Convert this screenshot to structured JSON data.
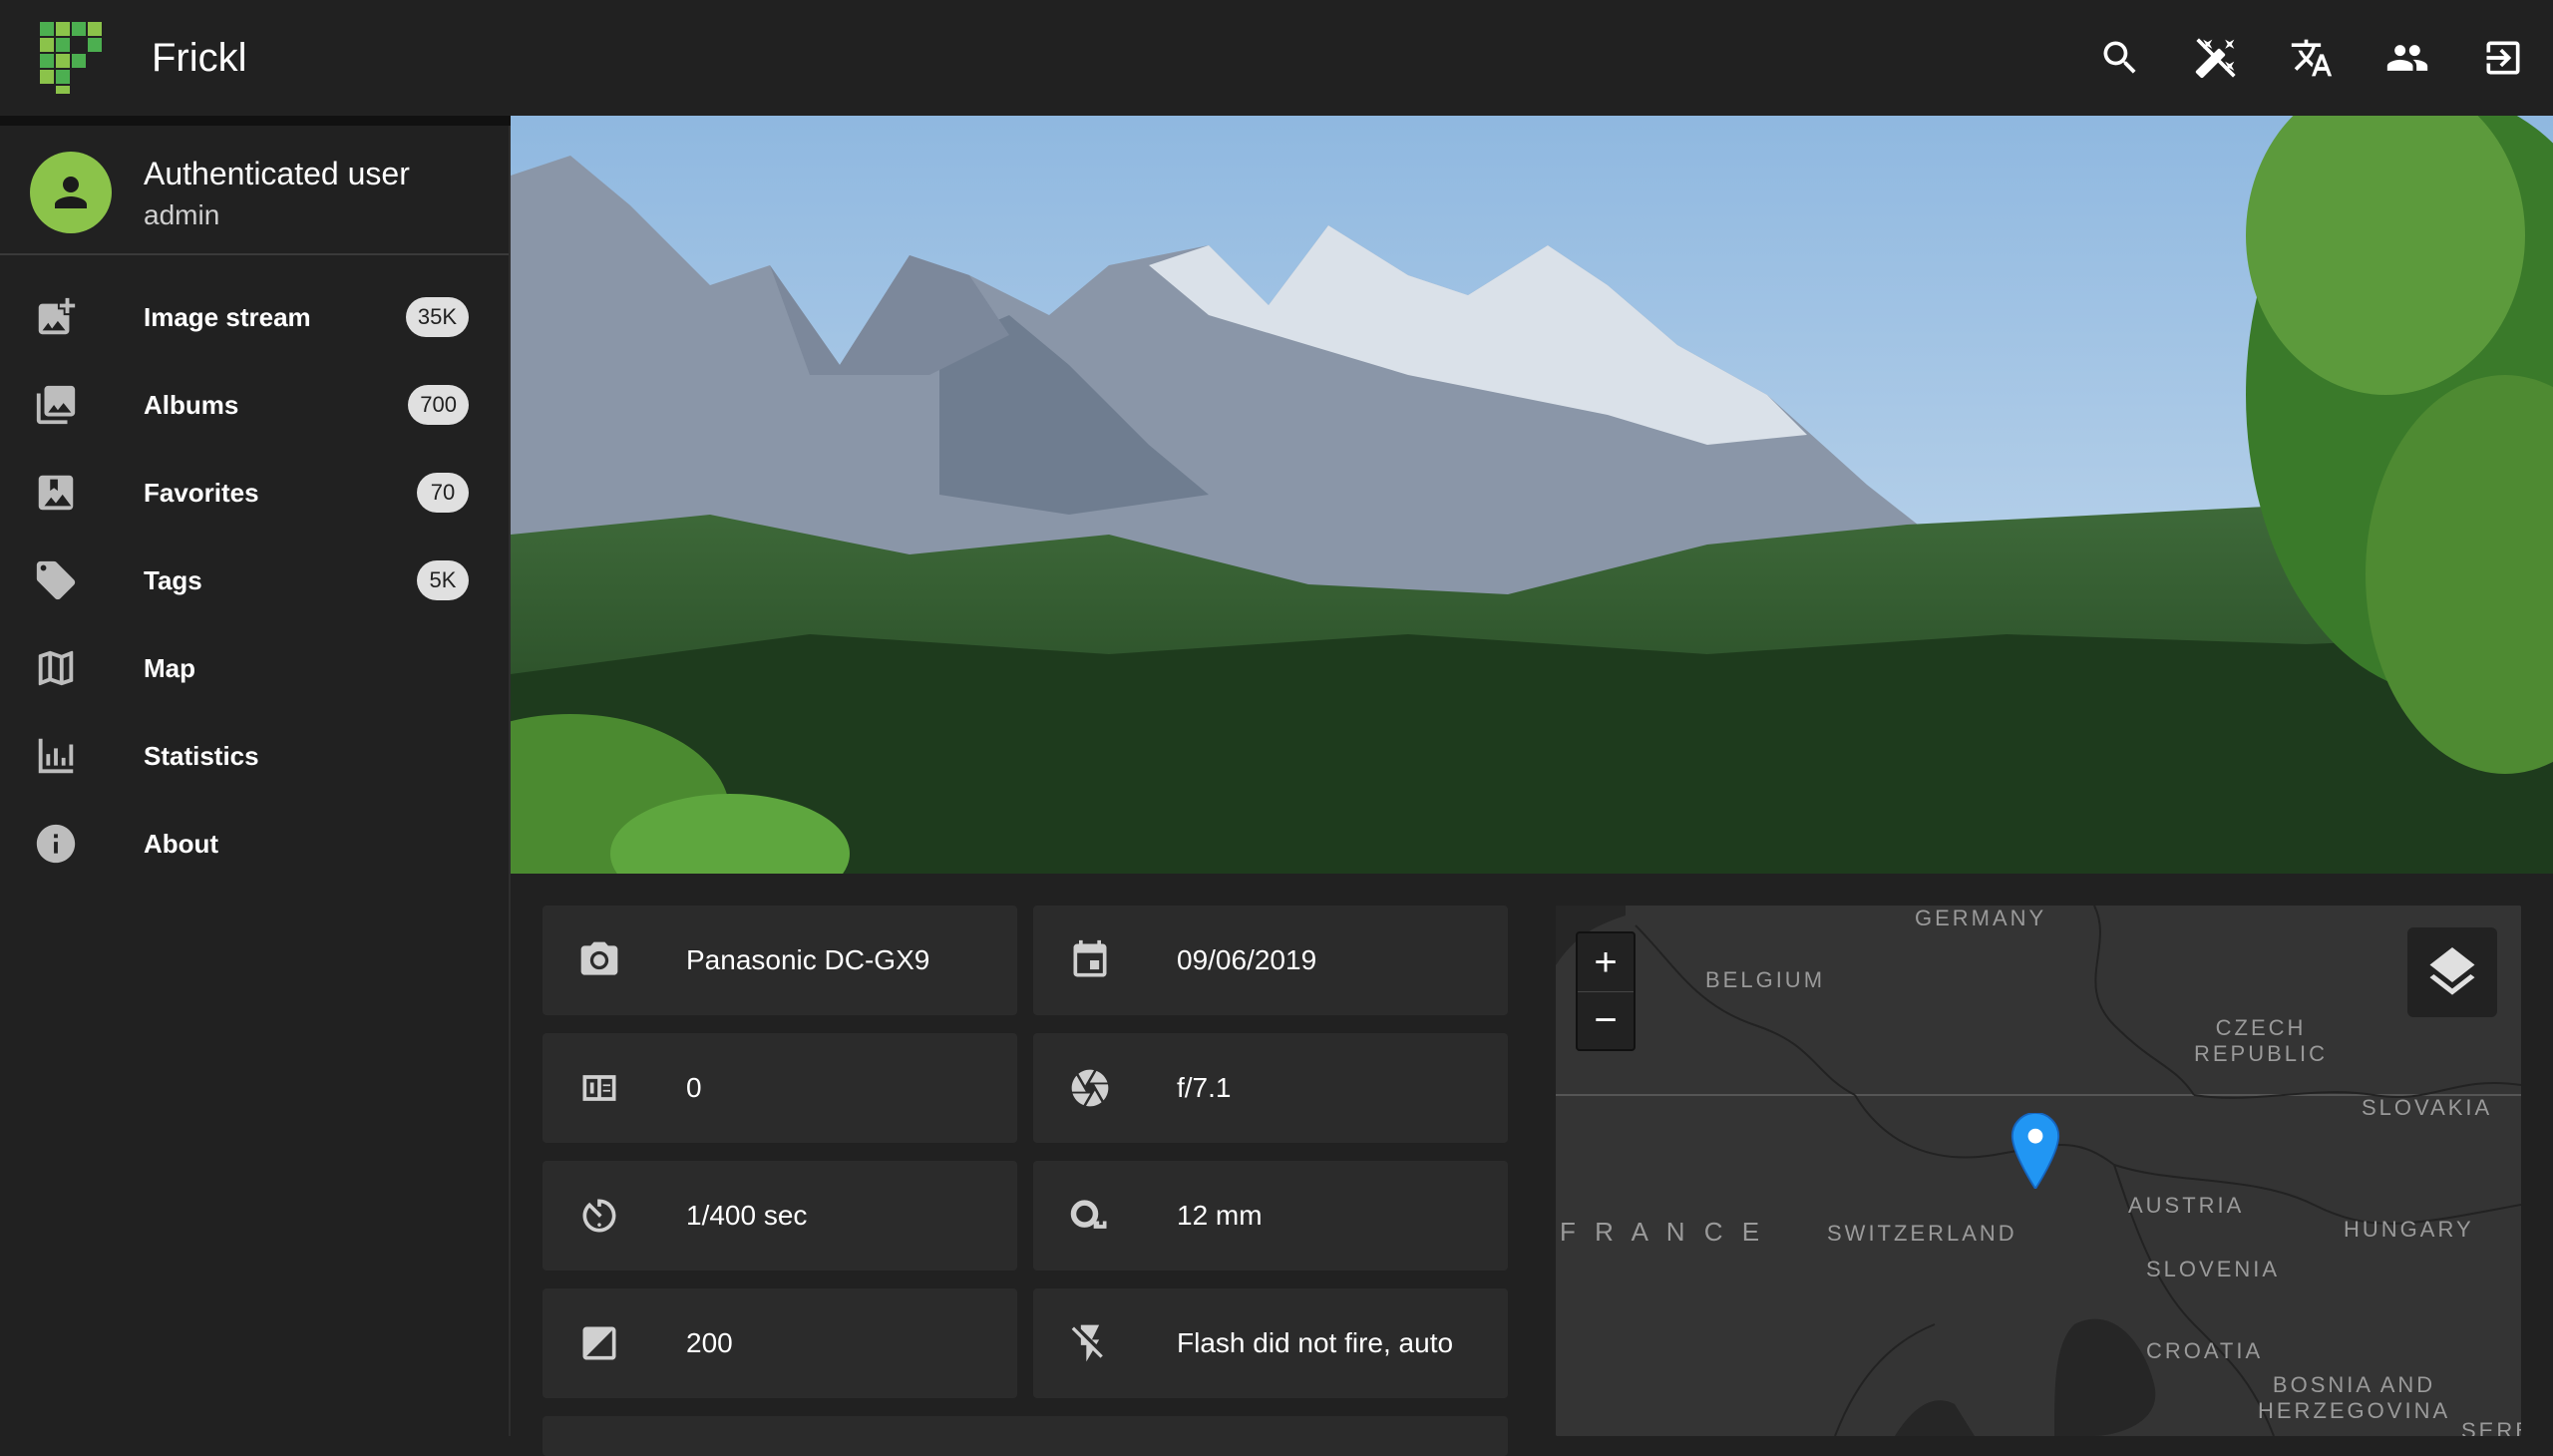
{
  "app": {
    "title": "Frickl"
  },
  "topbar": {
    "icons": [
      "search-icon",
      "magic-wand-off-icon",
      "translate-icon",
      "users-icon",
      "logout-icon"
    ]
  },
  "user": {
    "title": "Authenticated user",
    "name": "admin"
  },
  "sidebar": {
    "items": [
      {
        "label": "Image stream",
        "badge": "35K",
        "icon": "image-stream-icon"
      },
      {
        "label": "Albums",
        "badge": "700",
        "icon": "albums-icon"
      },
      {
        "label": "Favorites",
        "badge": "70",
        "icon": "favorites-icon"
      },
      {
        "label": "Tags",
        "badge": "5K",
        "icon": "tag-icon"
      },
      {
        "label": "Map",
        "badge": "",
        "icon": "map-icon"
      },
      {
        "label": "Statistics",
        "badge": "",
        "icon": "statistics-icon"
      },
      {
        "label": "About",
        "badge": "",
        "icon": "info-icon"
      }
    ]
  },
  "exif": {
    "camera": "Panasonic DC-GX9",
    "date": "09/06/2019",
    "exposure_program": "0",
    "aperture": "f/7.1",
    "shutter": "1/400 sec",
    "focal_length": "12 mm",
    "iso": "200",
    "flash": "Flash did not fire, auto"
  },
  "map": {
    "labels": {
      "germany": "GERMANY",
      "belgium": "BELGIUM",
      "czech": "CZECH\nREPUBLIC",
      "slovakia": "SLOVAKIA",
      "france": "F R A N C E",
      "switzerland": "SWITZERLAND",
      "austria": "AUSTRIA",
      "hungary": "HUNGARY",
      "slovenia": "SLOVENIA",
      "croatia": "CROATIA",
      "bosnia": "BOSNIA AND\nHERZEGOVINA",
      "serbia": "SERBI"
    },
    "zoom_in": "+",
    "zoom_out": "−",
    "marker_color": "#2196f3"
  },
  "colors": {
    "accent": "#8bc34a",
    "background": "#212121",
    "card": "#2b2b2b"
  }
}
